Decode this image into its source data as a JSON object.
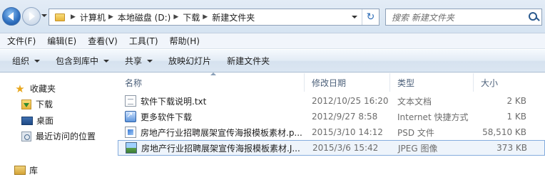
{
  "address": {
    "breadcrumbs": [
      "计算机",
      "本地磁盘 (D:)",
      "下载",
      "新建文件夹"
    ],
    "search_placeholder": "搜索 新建文件夹"
  },
  "menu": [
    "文件(F)",
    "编辑(E)",
    "查看(V)",
    "工具(T)",
    "帮助(H)"
  ],
  "commands": [
    {
      "label": "组织",
      "dropdown": true
    },
    {
      "label": "包含到库中",
      "dropdown": true
    },
    {
      "label": "共享",
      "dropdown": true
    },
    {
      "label": "放映幻灯片",
      "dropdown": false
    },
    {
      "label": "新建文件夹",
      "dropdown": false
    }
  ],
  "nav": {
    "favorites": "收藏夹",
    "downloads": "下载",
    "desktop": "桌面",
    "recent": "最近访问的位置",
    "libraries": "库"
  },
  "columns": {
    "name": "名称",
    "date": "修改日期",
    "type": "类型",
    "size": "大小"
  },
  "files": [
    {
      "icon": "text-file-icon",
      "name": "软件下载说明.txt",
      "date": "2012/10/25 16:20",
      "type": "文本文档",
      "size": "2 KB"
    },
    {
      "icon": "shortcut-icon",
      "name": "更多软件下载",
      "date": "2012/9/27 8:58",
      "type": "Internet 快捷方式",
      "size": "1 KB"
    },
    {
      "icon": "psd-file-icon",
      "name": "房地产行业招聘展架宣传海报模板素材.p...",
      "date": "2015/3/10 14:12",
      "type": "PSD 文件",
      "size": "58,510 KB"
    },
    {
      "icon": "jpeg-file-icon",
      "name": "房地产行业招聘展架宣传海报模板素材.J...",
      "date": "2015/3/6 15:42",
      "type": "JPEG 图像",
      "size": "373 KB"
    }
  ],
  "selected_row": 3,
  "colors": {
    "selection_border": "#84acdd",
    "selection_fill": "#eef4fb",
    "header_text": "#4c607a"
  }
}
